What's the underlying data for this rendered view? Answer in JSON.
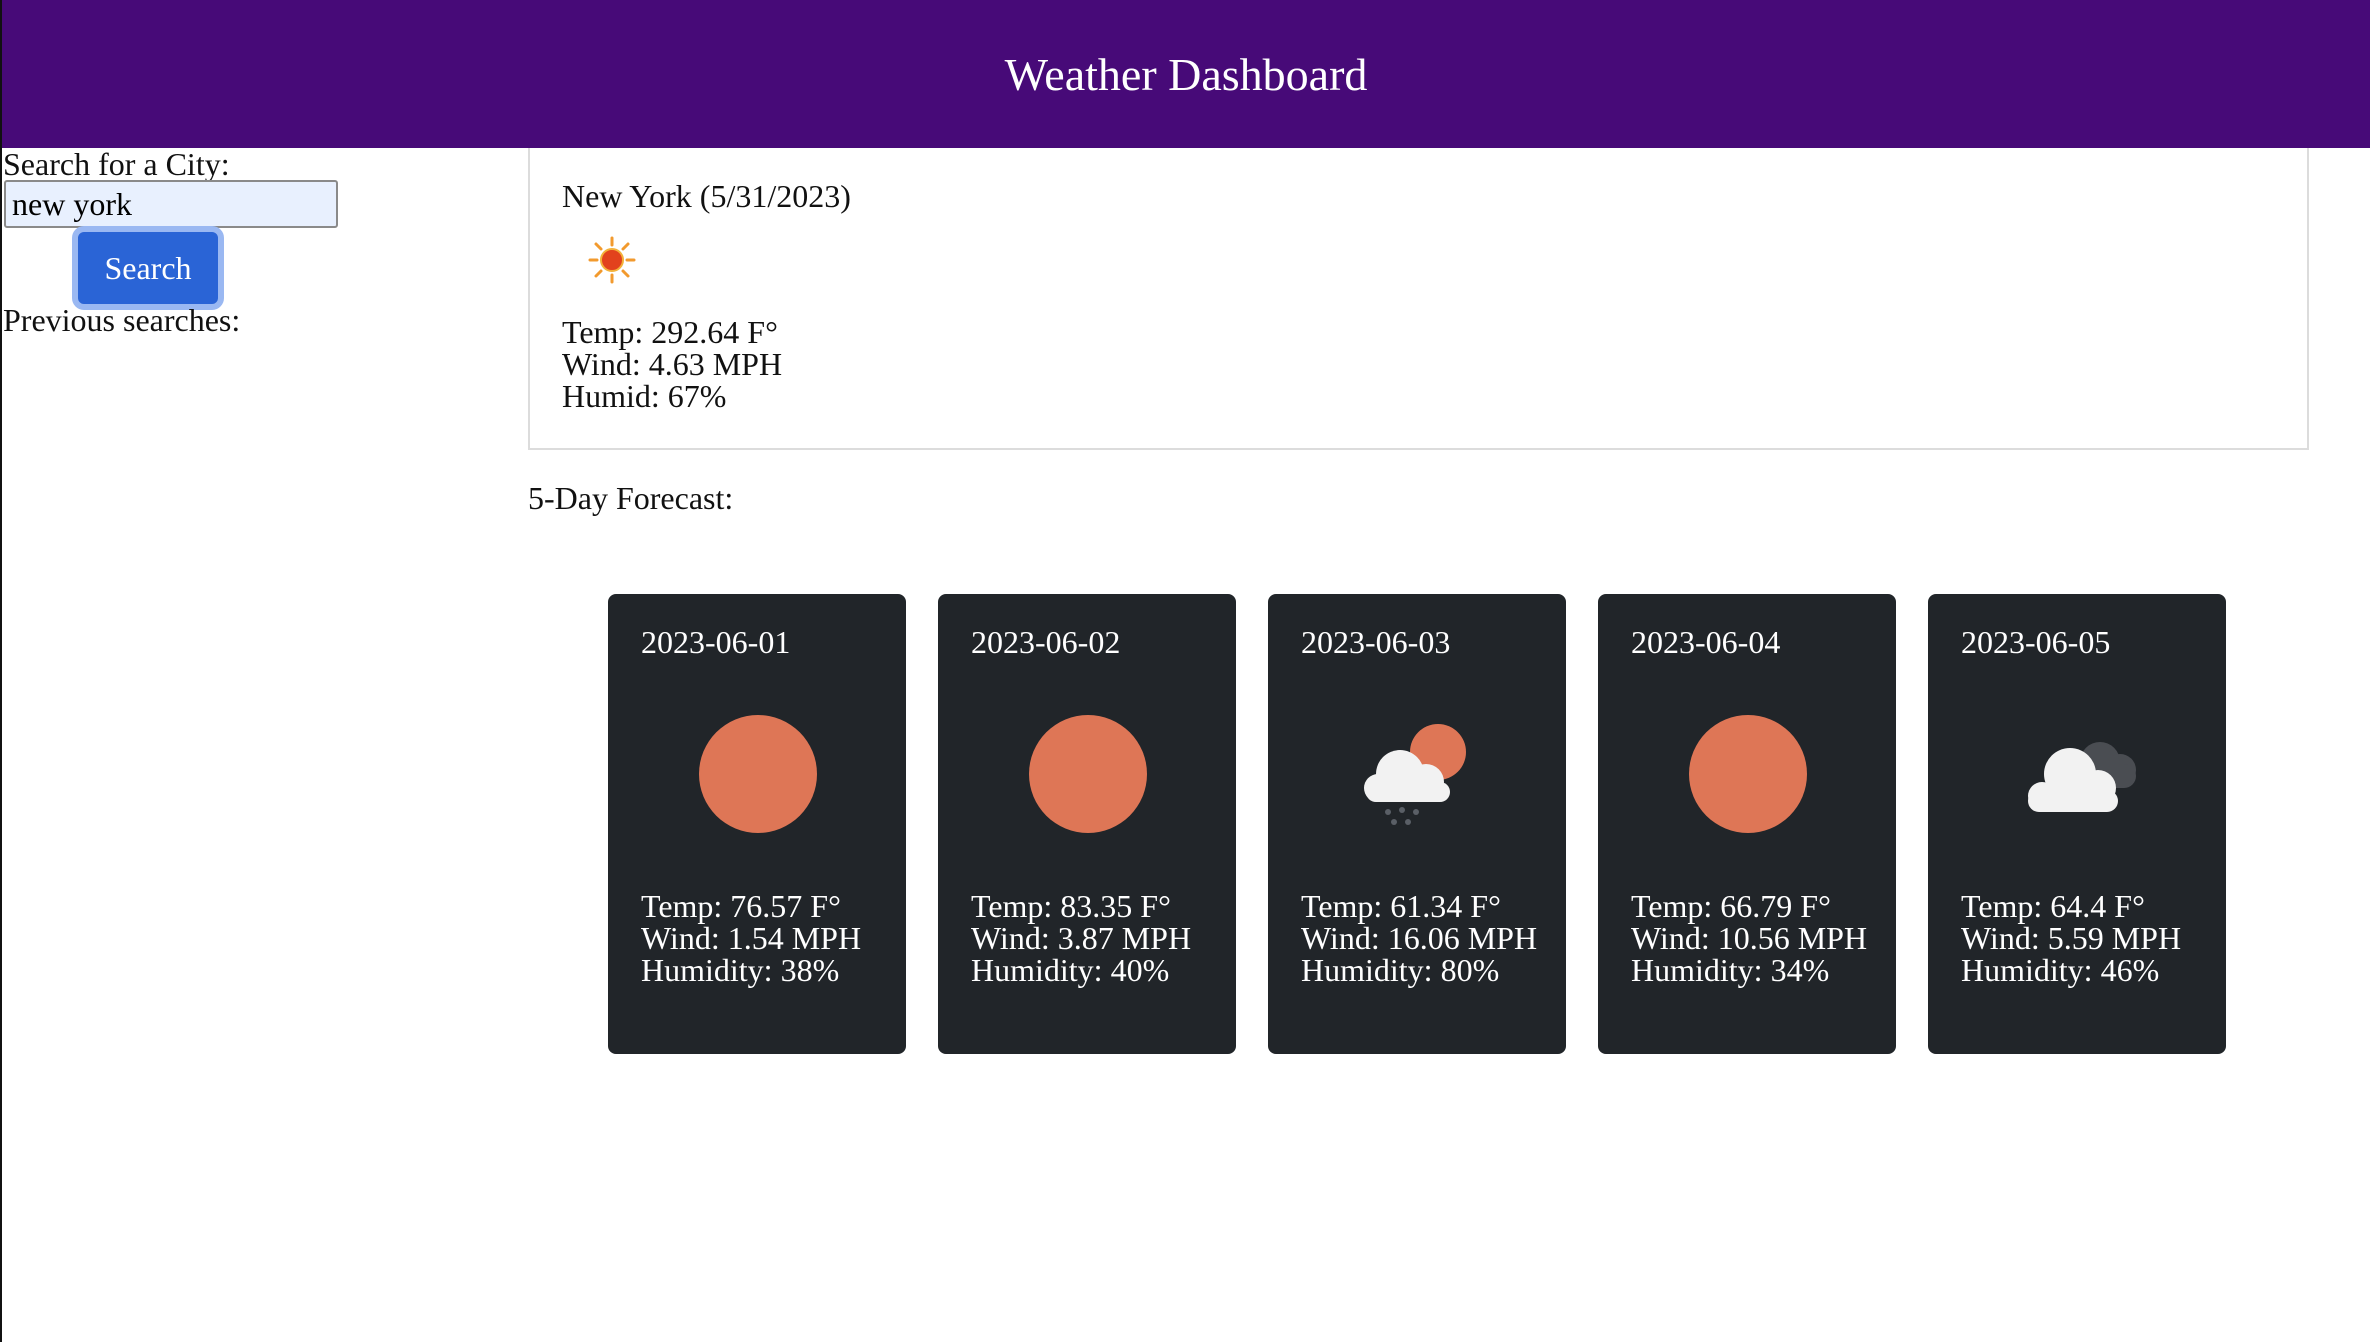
{
  "header": {
    "title": "Weather Dashboard",
    "background": "#470a78"
  },
  "sidebar": {
    "search_label": "Search for a City:",
    "search_value": "new york",
    "search_button": "Search",
    "previous_label": "Previous searches:",
    "button_color": "#2a64d6"
  },
  "current": {
    "city_date": "New York (5/31/2023)",
    "icon": "sun-icon",
    "temp": "Temp: 292.64 F°",
    "wind": "Wind: 4.63 MPH",
    "humid": "Humid: 67%"
  },
  "forecast": {
    "title": "5-Day Forecast:",
    "card_color": "#212529",
    "days": [
      {
        "date": "2023-06-01",
        "icon": "sun-icon",
        "temp": "Temp: 76.57 F°",
        "wind": "Wind: 1.54 MPH",
        "humidity": "Humidity: 38%"
      },
      {
        "date": "2023-06-02",
        "icon": "sun-icon",
        "temp": "Temp: 83.35 F°",
        "wind": "Wind: 3.87 MPH",
        "humidity": "Humidity: 40%"
      },
      {
        "date": "2023-06-03",
        "icon": "rain-cloud-sun-icon",
        "temp": "Temp: 61.34 F°",
        "wind": "Wind: 16.06 MPH",
        "humidity": "Humidity: 80%"
      },
      {
        "date": "2023-06-04",
        "icon": "sun-icon",
        "temp": "Temp: 66.79 F°",
        "wind": "Wind: 10.56 MPH",
        "humidity": "Humidity: 34%"
      },
      {
        "date": "2023-06-05",
        "icon": "cloudy-icon",
        "temp": "Temp: 64.4 F°",
        "wind": "Wind: 5.59 MPH",
        "humidity": "Humidity: 46%"
      }
    ]
  }
}
